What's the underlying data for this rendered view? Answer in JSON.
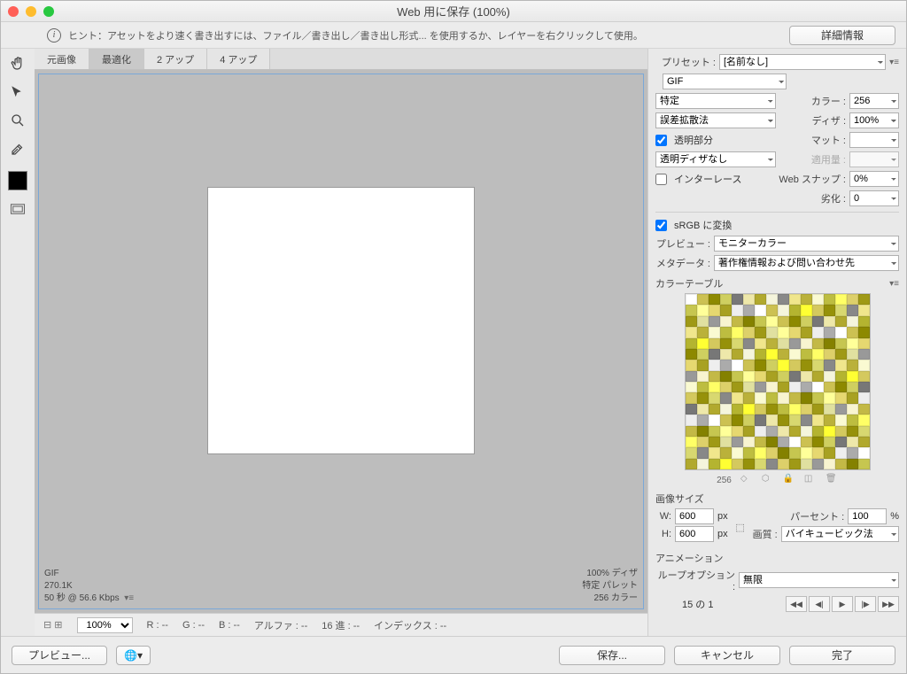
{
  "title": "Web 用に保存 (100%)",
  "hint": "ヒント：アセットをより速く書き出すには、ファイル／書き出し／書き出し形式... を使用するか、レイヤーを右クリックして使用。",
  "detail_btn": "詳細情報",
  "tabs": {
    "original": "元画像",
    "optimized": "最適化",
    "two_up": "2 アップ",
    "four_up": "4 アップ"
  },
  "canvas_info": {
    "format": "GIF",
    "size": "270.1K",
    "time": "50 秒 @ 56.6 Kbps",
    "dither_pct": "100% ディザ",
    "palette": "特定 パレット",
    "colors": "256 カラー"
  },
  "info_row": {
    "zoom": "100%",
    "r": "R : --",
    "g": "G : --",
    "b": "B : --",
    "alpha": "アルファ : --",
    "hex": "16 進 : --",
    "index": "インデックス : --"
  },
  "preset": {
    "label": "プリセット :",
    "value": "[名前なし]"
  },
  "format": {
    "value": "GIF"
  },
  "reduction": {
    "label": "",
    "value": "特定",
    "colors_label": "カラー :",
    "colors": "256"
  },
  "dither": {
    "method": "誤差拡散法",
    "label": "ディザ :",
    "amount": "100%"
  },
  "transparency": {
    "label": "透明部分",
    "matte_label": "マット :"
  },
  "trans_dither": {
    "value": "透明ディザなし",
    "amount_label": "適用量 :"
  },
  "interlace": {
    "label": "インターレース",
    "snap_label": "Web スナップ :",
    "snap": "0%"
  },
  "lossy": {
    "label": "劣化 :",
    "value": "0"
  },
  "srgb": {
    "label": "sRGB に変換"
  },
  "preview": {
    "label": "プレビュー :",
    "value": "モニターカラー"
  },
  "metadata": {
    "label": "メタデータ :",
    "value": "著作権情報および問い合わせ先"
  },
  "color_table": {
    "label": "カラーテーブル",
    "count": "256"
  },
  "image_size": {
    "label": "画像サイズ",
    "w_label": "W:",
    "w": "600",
    "px": "px",
    "h_label": "H:",
    "h": "600",
    "percent_label": "パーセント :",
    "percent": "100",
    "pct_unit": "%",
    "quality_label": "画質 :",
    "quality": "バイキュービック法"
  },
  "animation": {
    "label": "アニメーション",
    "loop_label": "ループオプション :",
    "loop": "無限",
    "frame": "15 の 1"
  },
  "buttons": {
    "preview": "プレビュー...",
    "save": "保存...",
    "cancel": "キャンセル",
    "done": "完了"
  }
}
